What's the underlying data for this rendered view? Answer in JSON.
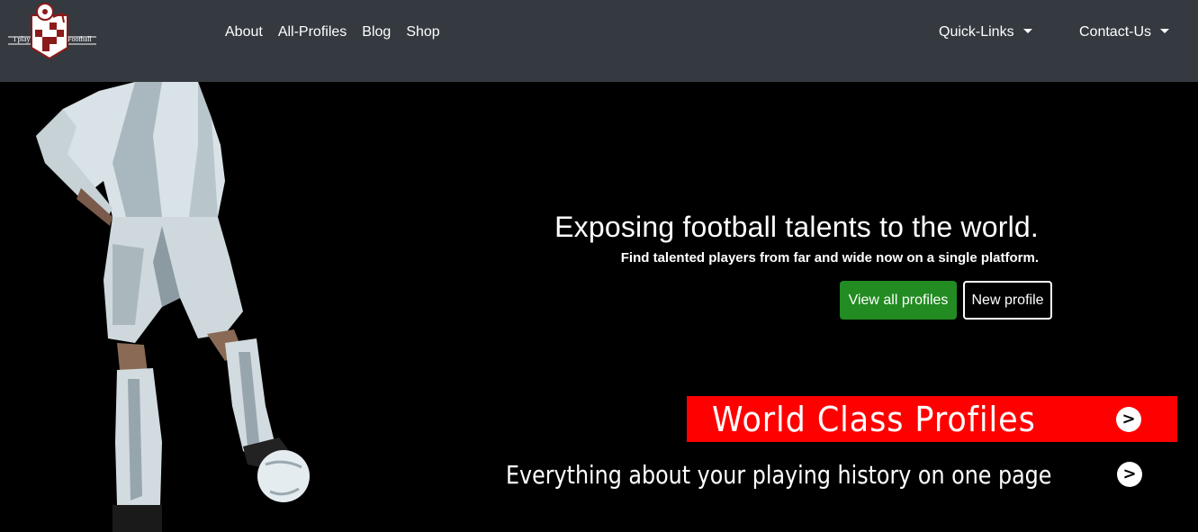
{
  "brand": {
    "logo_left_text": "I play",
    "logo_right_text": "Football",
    "logo_colors": {
      "primary": "#8b1a1a",
      "secondary": "#ffffff"
    }
  },
  "nav": {
    "links": [
      "About",
      "All-Profiles",
      "Blog",
      "Shop"
    ],
    "dropdowns": [
      "Quick-Links",
      "Contact-Us"
    ],
    "background": "#343a40"
  },
  "hero": {
    "title": "Exposing football talents to the world.",
    "subtitle": "Find talented players from far and wide now on a single platform.",
    "primary_button": "View all profiles",
    "secondary_button": "New profile",
    "primary_button_color": "#228b22",
    "banner_text": "World Class Profiles",
    "banner_color": "#ff0000",
    "tagline": "Everything about your playing history on one page",
    "arrow_glyph": ">"
  }
}
